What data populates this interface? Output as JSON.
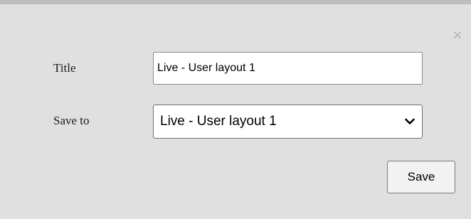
{
  "dialog": {
    "close_glyph": "×",
    "title_label": "Title",
    "title_value": "Live - User layout 1",
    "save_to_label": "Save to",
    "save_to_value": "Live - User layout 1",
    "save_button_label": "Save"
  },
  "icons": {
    "close": "close-icon",
    "dropdown": "chevron-down-icon"
  },
  "colors": {
    "dialog_background": "#e0e0e0",
    "top_border": "#bdbdbd",
    "close_icon": "#b0b0b0"
  }
}
